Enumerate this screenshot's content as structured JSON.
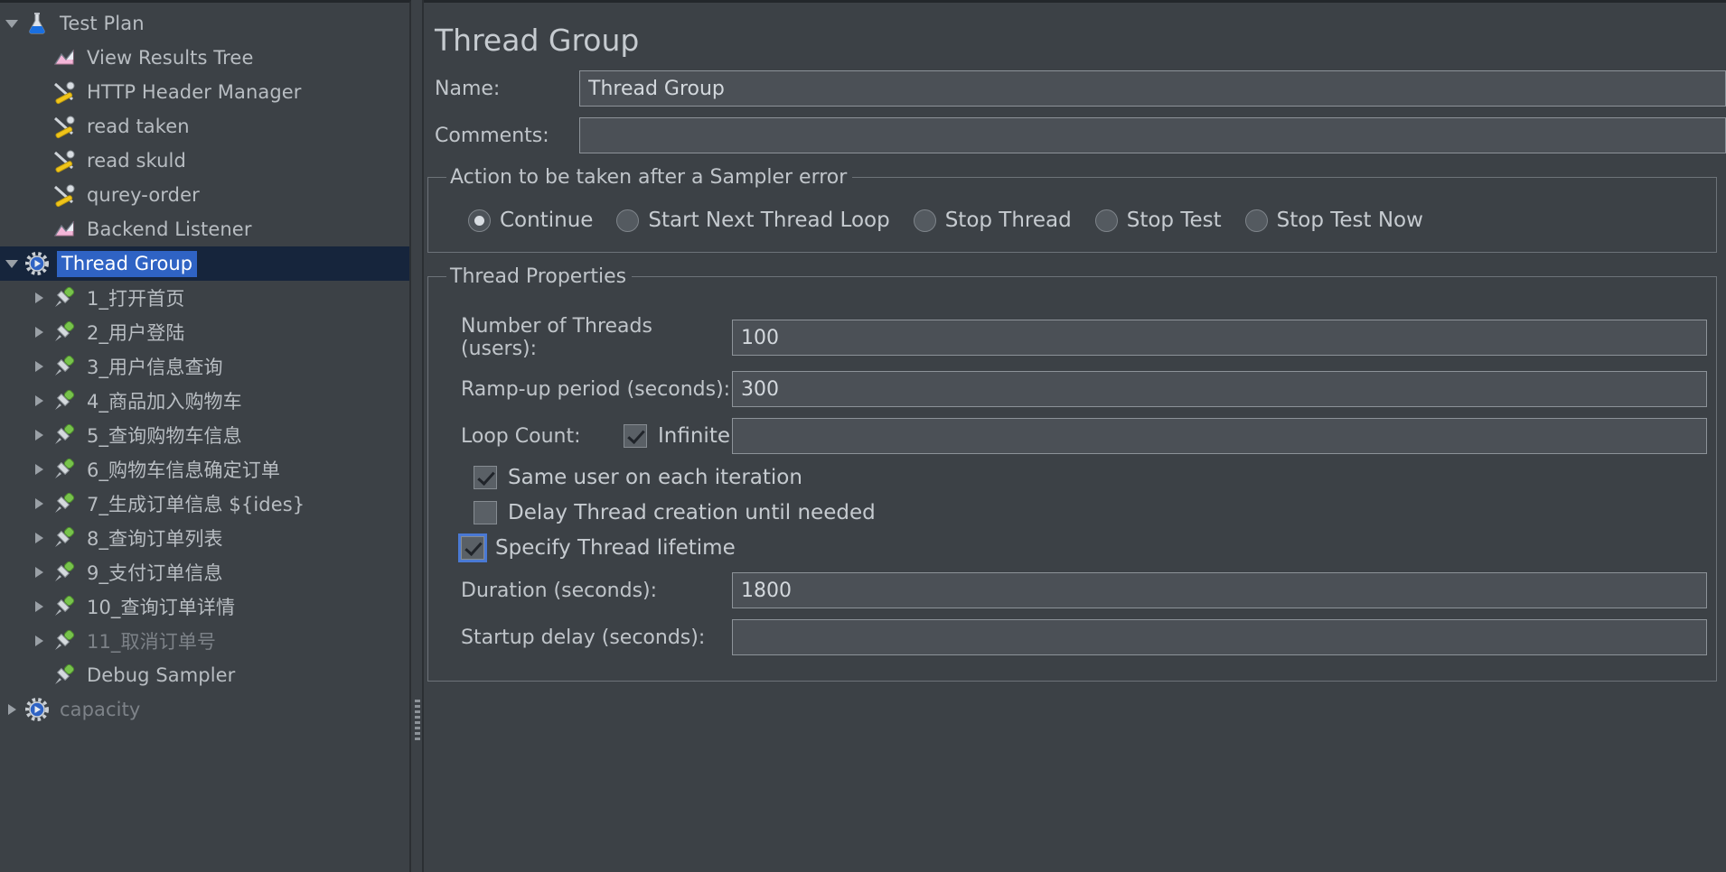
{
  "tree": {
    "nodes": [
      {
        "label": "Test Plan",
        "icon": "flask-icon",
        "indent": 0,
        "twisty": "open",
        "selected": false,
        "disabled": false
      },
      {
        "label": "View Results Tree",
        "icon": "listener-icon",
        "indent": 1,
        "twisty": "none",
        "selected": false,
        "disabled": false
      },
      {
        "label": "HTTP Header Manager",
        "icon": "config-element-icon",
        "indent": 1,
        "twisty": "none",
        "selected": false,
        "disabled": false
      },
      {
        "label": "read taken",
        "icon": "config-element-icon",
        "indent": 1,
        "twisty": "none",
        "selected": false,
        "disabled": false
      },
      {
        "label": "read skuld",
        "icon": "config-element-icon",
        "indent": 1,
        "twisty": "none",
        "selected": false,
        "disabled": false
      },
      {
        "label": "qurey-order",
        "icon": "config-element-icon",
        "indent": 1,
        "twisty": "none",
        "selected": false,
        "disabled": false
      },
      {
        "label": "Backend Listener",
        "icon": "listener-icon",
        "indent": 1,
        "twisty": "none",
        "selected": false,
        "disabled": false
      },
      {
        "label": "Thread Group",
        "icon": "thread-group-icon",
        "indent": 0,
        "twisty": "open",
        "selected": true,
        "disabled": false
      },
      {
        "label": "1_打开首页",
        "icon": "http-sampler-icon",
        "indent": 1,
        "twisty": "closed",
        "selected": false,
        "disabled": false
      },
      {
        "label": "2_用户登陆",
        "icon": "http-sampler-icon",
        "indent": 1,
        "twisty": "closed",
        "selected": false,
        "disabled": false
      },
      {
        "label": "3_用户信息查询",
        "icon": "http-sampler-icon",
        "indent": 1,
        "twisty": "closed",
        "selected": false,
        "disabled": false
      },
      {
        "label": "4_商品加入购物车",
        "icon": "http-sampler-icon",
        "indent": 1,
        "twisty": "closed",
        "selected": false,
        "disabled": false
      },
      {
        "label": "5_查询购物车信息",
        "icon": "http-sampler-icon",
        "indent": 1,
        "twisty": "closed",
        "selected": false,
        "disabled": false
      },
      {
        "label": "6_购物车信息确定订单",
        "icon": "http-sampler-icon",
        "indent": 1,
        "twisty": "closed",
        "selected": false,
        "disabled": false
      },
      {
        "label": "7_生成订单信息 ${ides}",
        "icon": "http-sampler-icon",
        "indent": 1,
        "twisty": "closed",
        "selected": false,
        "disabled": false
      },
      {
        "label": "8_查询订单列表",
        "icon": "http-sampler-icon",
        "indent": 1,
        "twisty": "closed",
        "selected": false,
        "disabled": false
      },
      {
        "label": "9_支付订单信息",
        "icon": "http-sampler-icon",
        "indent": 1,
        "twisty": "closed",
        "selected": false,
        "disabled": false
      },
      {
        "label": "10_查询订单详情",
        "icon": "http-sampler-icon",
        "indent": 1,
        "twisty": "closed",
        "selected": false,
        "disabled": false
      },
      {
        "label": "11_取消订单号",
        "icon": "http-sampler-icon",
        "indent": 1,
        "twisty": "closed",
        "selected": false,
        "disabled": true
      },
      {
        "label": "Debug Sampler",
        "icon": "http-sampler-icon",
        "indent": 1,
        "twisty": "none",
        "selected": false,
        "disabled": false
      },
      {
        "label": "capacity",
        "icon": "thread-group-icon",
        "indent": 0,
        "twisty": "closed",
        "selected": false,
        "disabled": true
      }
    ]
  },
  "main": {
    "title": "Thread Group",
    "name_label": "Name:",
    "name_value": "Thread Group",
    "comments_label": "Comments:",
    "comments_value": "",
    "comments_placeholder": "",
    "error_action": {
      "legend": "Action to be taken after a Sampler error",
      "selected": "Continue",
      "options": [
        {
          "label": "Continue",
          "checked": true
        },
        {
          "label": "Start Next Thread Loop",
          "checked": false
        },
        {
          "label": "Stop Thread",
          "checked": false
        },
        {
          "label": "Stop Test",
          "checked": false
        },
        {
          "label": "Stop Test Now",
          "checked": false
        }
      ]
    },
    "thread_properties": {
      "legend": "Thread Properties",
      "num_threads_label": "Number of Threads (users):",
      "num_threads_value": "100",
      "rampup_label": "Ramp-up period (seconds):",
      "rampup_value": "300",
      "loop_count_label": "Loop Count:",
      "loop_infinite_label": "Infinite",
      "loop_infinite_checked": true,
      "loop_count_value": "",
      "same_user_label": "Same user on each iteration",
      "same_user_checked": true,
      "delay_thread_label": "Delay Thread creation until needed",
      "delay_thread_checked": false,
      "specify_lifetime_label": "Specify Thread lifetime",
      "specify_lifetime_checked": true,
      "duration_label": "Duration (seconds):",
      "duration_value": "1800",
      "startup_delay_label": "Startup delay (seconds):",
      "startup_delay_value": ""
    }
  },
  "colors": {
    "window_bg": "#3c4146",
    "field_bg": "#4b5056",
    "text": "#c6cbd0",
    "selection_bg": "#2f63c4",
    "selection_row_bg": "#16253c",
    "focus_ring": "#4a79d4"
  }
}
